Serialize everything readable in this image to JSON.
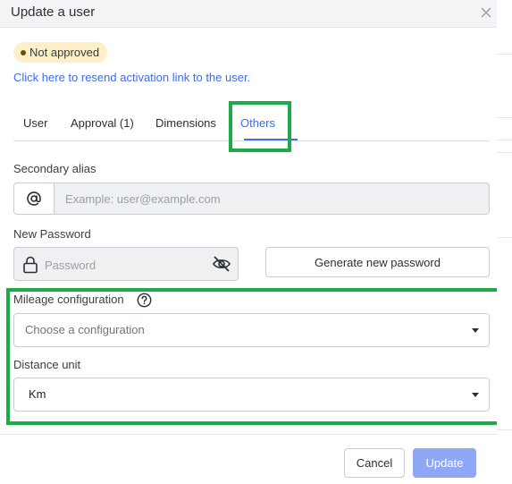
{
  "dialog": {
    "title": "Update a user",
    "close_icon": "close-icon"
  },
  "status": {
    "badge_label": "Not approved",
    "badge_color": "#fdf0c8",
    "resend_link": "Click here to resend activation link to the user."
  },
  "tabs": [
    {
      "label": "User"
    },
    {
      "label": "Approval (1)"
    },
    {
      "label": "Dimensions"
    },
    {
      "label": "Others",
      "active": true
    }
  ],
  "form": {
    "secondary_alias": {
      "label": "Secondary alias",
      "prefix_icon": "at-sign-icon",
      "placeholder": "Example: user@example.com",
      "value": ""
    },
    "new_password": {
      "label": "New Password",
      "placeholder": "Password",
      "lock_icon": "lock-icon",
      "visibility_icon": "eye-off-icon",
      "generate_button": "Generate new password"
    },
    "mileage_configuration": {
      "label": "Mileage configuration",
      "help_icon": "question-circle-icon",
      "placeholder": "Choose a configuration",
      "value": ""
    },
    "distance_unit": {
      "label": "Distance unit",
      "value": "Km"
    }
  },
  "footer": {
    "cancel_label": "Cancel",
    "update_label": "Update"
  },
  "colors": {
    "accent": "#3d6cf0",
    "highlight": "#1faa4a",
    "update_button": "#8fa8f5"
  }
}
